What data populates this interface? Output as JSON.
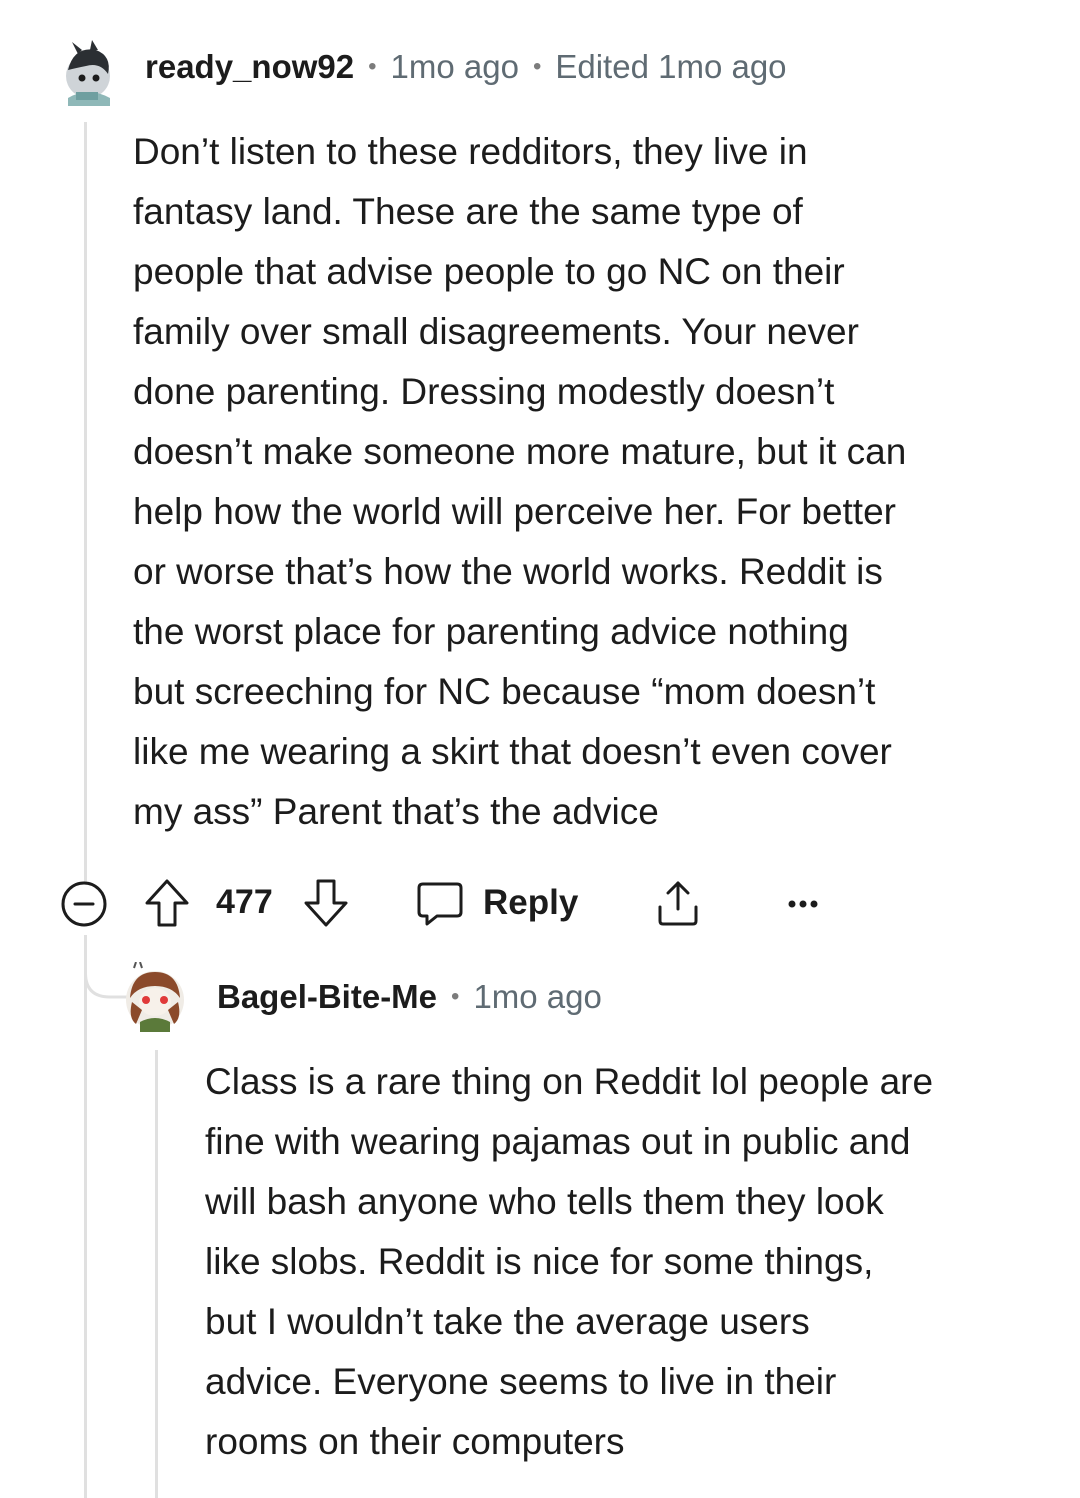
{
  "comment": {
    "author": "ready_now92",
    "time": "1mo ago",
    "edited": "Edited 1mo ago",
    "body": "Don’t listen to these redditors, they live in\nfantasy land. These are the same type of\npeople that advise people to go NC on their\nfamily over small disagreements. Your never\ndone parenting. Dressing modestly doesn’t\ndoesn’t make someone more mature, but it can\nhelp how the world will perceive her. For better\nor worse that’s how the world works. Reddit is\nthe worst place for parenting advice nothing\nbut screeching for NC because “mom doesn’t\nlike me wearing a skirt that doesn’t even cover\nmy ass” Parent that’s the advice",
    "votes": "477",
    "reply_label": "Reply",
    "icons": [
      "collapse-icon",
      "upvote-icon",
      "downvote-icon",
      "reply-bubble-icon",
      "share-icon",
      "more-icon"
    ]
  },
  "reply": {
    "author": "Bagel-Bite-Me",
    "time": "1mo ago",
    "body": "Class is a rare thing on Reddit lol people are\nfine with wearing pajamas out in public and\nwill bash anyone who tells them they look\nlike slobs. Reddit is nice for some things,\nbut I wouldn’t take the average users\nadvice. Everyone seems to live in their\nrooms on their computers"
  },
  "colors": {
    "text": "#1c1c1c",
    "meta": "#5f6b73",
    "thread_line": "#e0e0e0",
    "accent_reply_avatar": "#a0522d"
  }
}
